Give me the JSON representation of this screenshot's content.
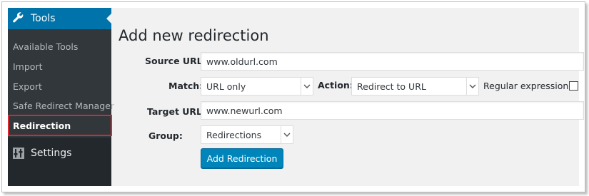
{
  "sidebar": {
    "tools_label": "Tools",
    "items": [
      {
        "label": "Available Tools"
      },
      {
        "label": "Import"
      },
      {
        "label": "Export"
      },
      {
        "label": "Safe Redirect Manager"
      },
      {
        "label": "Redirection"
      }
    ],
    "settings_label": "Settings"
  },
  "main": {
    "title": "Add new redirection",
    "source_url": {
      "label": "Source URL:",
      "value": "www.oldurl.com"
    },
    "match": {
      "label": "Match:",
      "selected": "URL only"
    },
    "action": {
      "label": "Action:",
      "selected": "Redirect to URL"
    },
    "regex": {
      "label": "Regular expression:",
      "checked": false
    },
    "target_url": {
      "label": "Target URL:",
      "value": "www.newurl.com"
    },
    "group": {
      "label": "Group:",
      "selected": "Redirections"
    },
    "submit_label": "Add Redirection"
  },
  "colors": {
    "sidebar_bg": "#23282d",
    "submenu_bg": "#32373c",
    "active_menu": "#0073aa",
    "highlight_box": "#d9262f",
    "primary_button": "#0085ba"
  },
  "icons": {
    "tools": "wrench-icon",
    "settings": "settings-icon"
  }
}
